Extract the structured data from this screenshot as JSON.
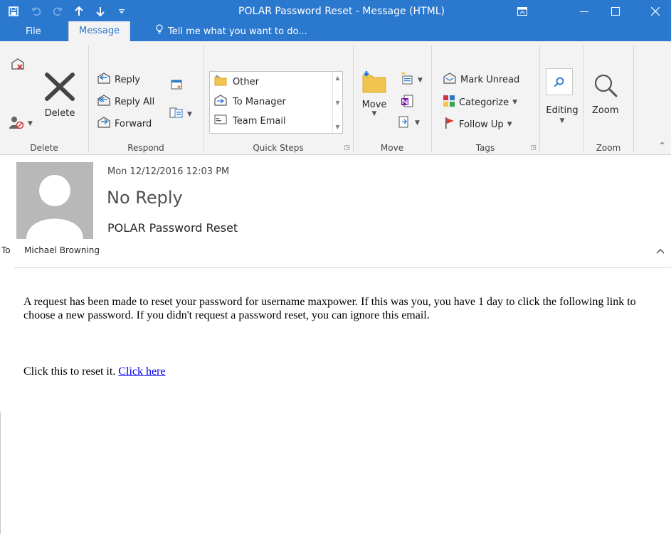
{
  "window": {
    "title": "POLAR Password Reset - Message (HTML)"
  },
  "tabs": [
    {
      "label": "File"
    },
    {
      "label": "Message"
    }
  ],
  "tell_me": "Tell me what you want to do...",
  "ribbon": {
    "delete_group": {
      "label": "Delete",
      "delete_label": "Delete"
    },
    "respond_group": {
      "label": "Respond",
      "reply": "Reply",
      "reply_all": "Reply All",
      "forward": "Forward"
    },
    "quick_steps_group": {
      "label": "Quick Steps",
      "items": [
        "Other",
        "To Manager",
        "Team Email"
      ]
    },
    "move_group": {
      "label": "Move",
      "move": "Move"
    },
    "tags_group": {
      "label": "Tags",
      "mark_unread": "Mark Unread",
      "categorize": "Categorize",
      "follow_up": "Follow Up"
    },
    "editing": {
      "label": "Editing"
    },
    "zoom_group": {
      "label": "Zoom",
      "zoom": "Zoom"
    }
  },
  "message": {
    "date": "Mon 12/12/2016 12:03 PM",
    "sender": "No Reply",
    "subject": "POLAR Password Reset",
    "to_label": "To",
    "to_name": "Michael Browning",
    "body_paragraph": "A request has been made to reset your password for username maxpower. If this was you, you have 1 day to click the following link to choose a new password. If you didn't request a password reset, you can ignore this email.",
    "body_prefix": "Click this to reset it.",
    "link_text": "Click here"
  },
  "colors": {
    "titlebar": "#2b78cf",
    "ribbon_bg": "#f3f3f3",
    "link": "#0000ee",
    "flag": "#e0382b"
  }
}
